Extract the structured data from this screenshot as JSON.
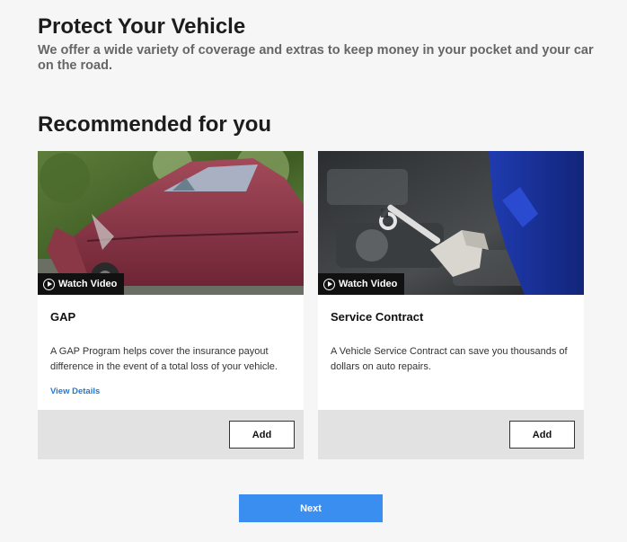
{
  "header": {
    "title": "Protect Your Vehicle",
    "subtitle": "We offer a wide variety of coverage and extras to keep money in your pocket and your car on the road."
  },
  "recommended": {
    "title": "Recommended for you",
    "cards": [
      {
        "title": "GAP",
        "description": "A GAP Program helps cover the insurance payout difference in the event of a total loss of your vehicle.",
        "watch_video_label": "Watch Video",
        "view_details_label": "View Details",
        "add_label": "Add"
      },
      {
        "title": "Service Contract",
        "description": "A Vehicle Service Contract can save you thousands of dollars on auto repairs.",
        "watch_video_label": "Watch Video",
        "add_label": "Add"
      }
    ]
  },
  "footer": {
    "next_label": "Next"
  },
  "colors": {
    "accent": "#3a8ef0",
    "link": "#1f7ad6",
    "background": "#f6f6f6",
    "card_footer": "#e2e2e2"
  }
}
